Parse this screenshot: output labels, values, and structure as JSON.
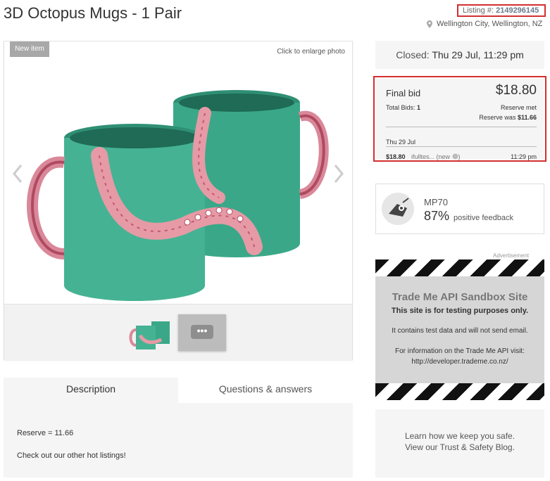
{
  "header": {
    "title": "3D Octopus Mugs - 1 Pair",
    "listing_label": "Listing #:",
    "listing_number": "2149296145",
    "location": "Wellington City, Wellington, NZ"
  },
  "gallery": {
    "badge": "New item",
    "enlarge_hint": "Click to enlarge photo",
    "more_photos": "•••"
  },
  "tabs": [
    {
      "label": "Description",
      "active": true
    },
    {
      "label": "Questions & answers",
      "active": false
    }
  ],
  "description": {
    "line1": "Reserve = 11.66",
    "line2": "Check out our other hot listings!"
  },
  "auction": {
    "closed_label": "Closed:",
    "closed_value": "Thu 29 Jul, 11:29 pm",
    "final_bid_label": "Final bid",
    "final_bid_amount": "$18.80",
    "total_bids_label": "Total Bids:",
    "total_bids_value": "1",
    "reserve_met": "Reserve met",
    "reserve_was_label": "Reserve was",
    "reserve_was_value": "$11.66",
    "history": {
      "date": "Thu 29 Jul",
      "amount": "$18.80",
      "bidder": "ifulltes... (new",
      "time": "11:29 pm"
    }
  },
  "seller": {
    "name": "MP70",
    "percent": "87%",
    "feedback_label": "positive feedback"
  },
  "advertisement": {
    "label": "Advertisement",
    "title": "Trade Me API Sandbox Site",
    "line1": "This site is for testing purposes only.",
    "line2": "It contains test data and will not send email.",
    "line3": "For information on the Trade Me API visit:",
    "line4": "http://developer.trademe.co.nz/"
  },
  "safety": {
    "line1": "Learn how we keep you safe.",
    "line2": "View our Trust & Safety Blog."
  },
  "colors": {
    "highlight_border": "#d32f2f",
    "mug_body": "#3aa888",
    "tentacle": "#e69aa6"
  }
}
